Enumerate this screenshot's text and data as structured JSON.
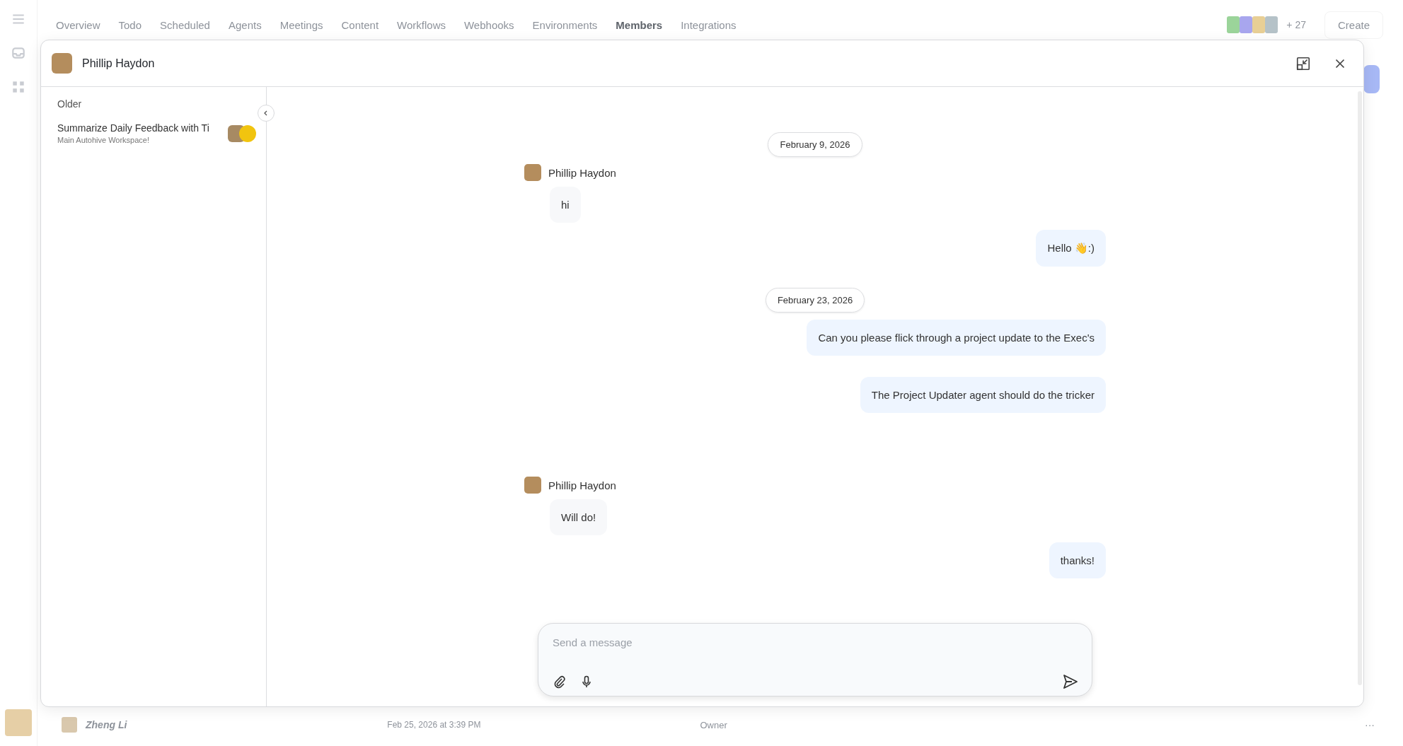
{
  "background_page": {
    "nav_tabs": [
      {
        "label": "Overview",
        "selected": false
      },
      {
        "label": "Todo",
        "selected": false
      },
      {
        "label": "Scheduled",
        "selected": false
      },
      {
        "label": "Agents",
        "selected": false
      },
      {
        "label": "Meetings",
        "selected": false
      },
      {
        "label": "Content",
        "selected": false
      },
      {
        "label": "Workflows",
        "selected": false
      },
      {
        "label": "Webhooks",
        "selected": false
      },
      {
        "label": "Environments",
        "selected": false
      },
      {
        "label": "Members",
        "selected": true
      },
      {
        "label": "Integrations",
        "selected": false
      }
    ],
    "member_count": "+ 27",
    "create_button": "Create",
    "member_row": {
      "name": "Zheng Li",
      "date": "Feb 25, 2026 at 3:39 PM",
      "role": "Owner",
      "more": "···"
    }
  },
  "chat_window": {
    "title": "Phillip Haydon",
    "sidebar": {
      "section": "Older",
      "items": [
        {
          "title": "Summarize Daily Feedback with Ti",
          "subtitle": "Main Autohive Workspace!",
          "selected": false
        }
      ]
    },
    "messages": [
      {
        "kind": "date",
        "text": "February 9, 2026"
      },
      {
        "kind": "incoming",
        "sender": "Phillip Haydon",
        "text": "hi"
      },
      {
        "kind": "outgoing",
        "text": "Hello 👋:)"
      },
      {
        "kind": "date",
        "text": "February 23, 2026"
      },
      {
        "kind": "outgoing",
        "text": "Can you please flick through a project update to the Exec's"
      },
      {
        "kind": "outgoing",
        "text": "The Project Updater agent should do the tricker"
      },
      {
        "kind": "incoming",
        "sender": "Phillip Haydon",
        "text": "Will do!"
      },
      {
        "kind": "outgoing",
        "text": "thanks!"
      }
    ],
    "composer": {
      "placeholder": "Send a message"
    }
  }
}
